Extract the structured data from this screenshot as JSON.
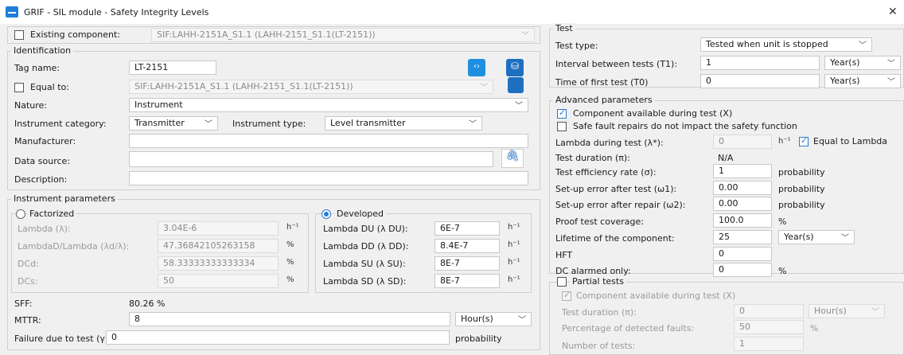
{
  "window": {
    "title": "GRIF - SIL module - Safety Integrity Levels",
    "close": "✕"
  },
  "existing_component": {
    "label": "Existing component:",
    "value": "SIF:LAHH-2151A_S1.1 (LAHH-2151_S1.1(LT-2151))"
  },
  "identification": {
    "title": "Identification",
    "tag_label": "Tag name:",
    "tag_value": "LT-2151",
    "equal_label": "Equal to:",
    "equal_value": "SIF:LAHH-2151A_S1.1 (LAHH-2151_S1.1(LT-2151))",
    "nature_label": "Nature:",
    "nature_value": "Instrument",
    "category_label": "Instrument category:",
    "category_value": "Transmitter",
    "type_label": "Instrument type:",
    "type_value": "Level transmitter",
    "manufacturer_label": "Manufacturer:",
    "manufacturer_value": "",
    "source_label": "Data source:",
    "source_value": "",
    "description_label": "Description:",
    "description_value": ""
  },
  "instrument_parameters": {
    "title": "Instrument parameters",
    "factorized": {
      "label": "Factorized",
      "rows": [
        {
          "label": "Lambda (λ):",
          "value": "3.04E-6",
          "unit": "h⁻¹"
        },
        {
          "label": "LambdaD/Lambda (λd/λ):",
          "value": "47.36842105263158",
          "unit": "%"
        },
        {
          "label": "DCd:",
          "value": "58.33333333333334",
          "unit": "%"
        },
        {
          "label": "DCs:",
          "value": "50",
          "unit": "%"
        }
      ]
    },
    "developed": {
      "label": "Developed",
      "rows": [
        {
          "label": "Lambda DU (λ DU):",
          "value": "6E-7",
          "unit": "h⁻¹"
        },
        {
          "label": "Lambda DD (λ DD):",
          "value": "8.4E-7",
          "unit": "h⁻¹"
        },
        {
          "label": "Lambda SU (λ SU):",
          "value": "8E-7",
          "unit": "h⁻¹"
        },
        {
          "label": "Lambda SD (λ SD):",
          "value": "8E-7",
          "unit": "h⁻¹"
        }
      ]
    },
    "sff_label": "SFF:",
    "sff_value": "80.26 %",
    "mttr_label": "MTTR:",
    "mttr_value": "8",
    "mttr_unit": "Hour(s)",
    "failure_label": "Failure due to test (γ):",
    "failure_value": "0",
    "failure_unit": "probability"
  },
  "test": {
    "title": "Test",
    "type_label": "Test type:",
    "type_value": "Tested when unit is stopped",
    "interval_label": "Interval between tests (T1):",
    "interval_value": "1",
    "interval_unit": "Year(s)",
    "first_label": "Time of first test (T0)",
    "first_value": "0",
    "first_unit": "Year(s)"
  },
  "advanced": {
    "title": "Advanced parameters",
    "cb1": "Component available during test (X)",
    "cb2": "Safe fault repairs do not impact the safety function",
    "lambda_test_label": "Lambda during test (λ*):",
    "lambda_test_value": "0",
    "lambda_test_unit": "h⁻¹",
    "equal_lambda": "Equal to Lambda",
    "duration_label": "Test duration (π):",
    "duration_value": "N/A",
    "efficiency_label": "Test efficiency rate (σ):",
    "efficiency_value": "1",
    "efficiency_unit": "probability",
    "setup_test_label": "Set-up error after test (ω1):",
    "setup_test_value": "0.00",
    "setup_test_unit": "probability",
    "setup_repair_label": "Set-up error after repair (ω2):",
    "setup_repair_value": "0.00",
    "setup_repair_unit": "probability",
    "coverage_label": "Proof test coverage:",
    "coverage_value": "100.0",
    "coverage_unit": "%",
    "lifetime_label": "Lifetime of the component:",
    "lifetime_value": "25",
    "lifetime_unit": "Year(s)",
    "hft_label": "HFT",
    "hft_value": "0",
    "dc_label": "DC alarmed only:",
    "dc_value": "0",
    "dc_unit": "%"
  },
  "partial": {
    "title": "Partial tests",
    "cb": "Component available during test (X)",
    "duration_label": "Test duration (π):",
    "duration_value": "0",
    "duration_unit": "Hour(s)",
    "detected_label": "Percentage of detected faults:",
    "detected_value": "50",
    "detected_unit": "%",
    "number_label": "Number of tests:",
    "number_value": "1"
  },
  "colors": {
    "accent": "#2a7bd4",
    "window_bg": "#f0f0f0"
  }
}
